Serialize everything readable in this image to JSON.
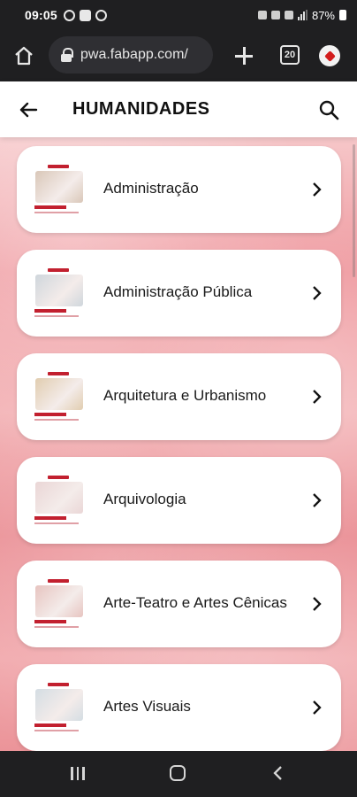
{
  "status_bar": {
    "time": "09:05",
    "battery": "87%"
  },
  "browser": {
    "url": "pwa.fabapp.com/",
    "tab_count": "20",
    "icons": [
      "home-icon",
      "lock-icon",
      "plus-icon",
      "tabs-icon",
      "profile-icon"
    ]
  },
  "header": {
    "title": "HUMANIDADES",
    "icons": [
      "back-arrow-icon",
      "search-icon"
    ]
  },
  "courses": [
    {
      "label": "Administração",
      "thumb_color": "#d9c7b8"
    },
    {
      "label": "Administração Pública",
      "thumb_color": "#cfd6dc"
    },
    {
      "label": "Arquitetura e Urbanismo",
      "thumb_color": "#e1cdb0"
    },
    {
      "label": "Arquivologia",
      "thumb_color": "#ead6d6"
    },
    {
      "label": "Arte-Teatro e Artes Cênicas",
      "thumb_color": "#e7c4c0"
    },
    {
      "label": "Artes Visuais",
      "thumb_color": "#d4dde3"
    }
  ],
  "nav": {
    "icons": [
      "recent-apps-icon",
      "home-icon",
      "back-icon"
    ]
  },
  "colors": {
    "brand_red": "#c2202f",
    "background_pink": "#ef9aa0"
  }
}
